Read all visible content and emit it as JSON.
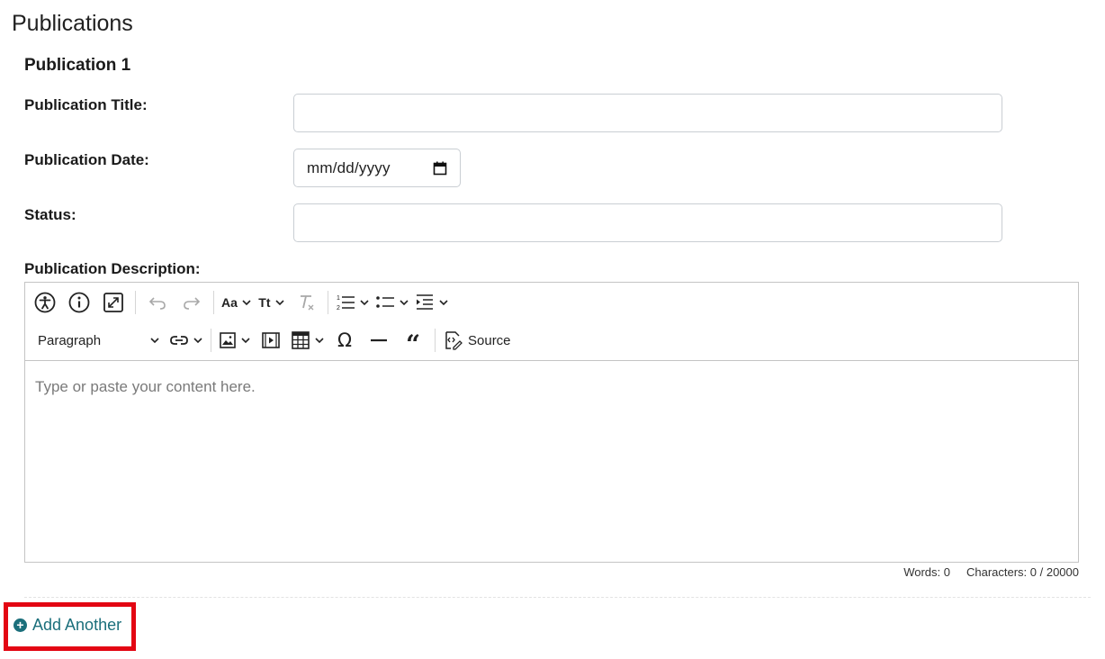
{
  "section": {
    "title": "Publications"
  },
  "publication": {
    "heading": "Publication 1",
    "title_label": "Publication Title:",
    "title_value": "",
    "date_label": "Publication Date:",
    "date_placeholder": "mm/dd/yyyy",
    "status_label": "Status:",
    "status_value": "",
    "description_label": "Publication Description:"
  },
  "editor": {
    "toolbar_row1": [
      "accessibility-icon",
      "info-icon",
      "fullscreen-icon",
      "undo-icon",
      "redo-icon",
      "font-family-icon",
      "font-size-icon",
      "remove-format-icon",
      "numbered-list-icon",
      "bulleted-list-icon",
      "indent-icon"
    ],
    "paragraph_label": "Paragraph",
    "source_label": "Source",
    "placeholder": "Type or paste your content here.",
    "words_label": "Words: 0",
    "characters_label": "Characters: 0 / 20000"
  },
  "actions": {
    "add_another_label": "Add Another"
  },
  "colors": {
    "link": "#1b6f7b",
    "highlight_border": "#e30613",
    "input_border": "#c9ced3"
  }
}
